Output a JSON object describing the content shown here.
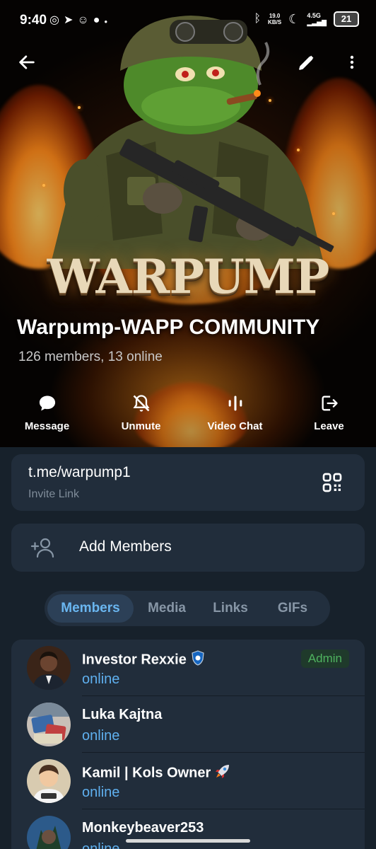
{
  "status_bar": {
    "time": "9:40",
    "speed_value": "19.0",
    "speed_unit": "KB/S",
    "network": "4.5G",
    "battery": "21"
  },
  "header": {
    "logo_text": "WARPUMP",
    "title": "Warpump-WAPP COMMUNITY",
    "subtitle": "126 members, 13 online"
  },
  "actions": [
    {
      "label": "Message",
      "icon": "chat-bubble-icon"
    },
    {
      "label": "Unmute",
      "icon": "bell-off-icon"
    },
    {
      "label": "Video Chat",
      "icon": "audio-bars-icon"
    },
    {
      "label": "Leave",
      "icon": "exit-icon"
    }
  ],
  "invite": {
    "url": "t.me/warpump1",
    "label": "Invite Link"
  },
  "add_members": {
    "label": "Add Members"
  },
  "tabs": [
    "Members",
    "Media",
    "Links",
    "GIFs"
  ],
  "members": [
    {
      "name": "Investor Rexxie",
      "status": "online",
      "badge": "Admin"
    },
    {
      "name": "Luka Kajtna",
      "status": "online"
    },
    {
      "name": "Kamil | Kols Owner",
      "status": "online"
    },
    {
      "name": "Monkeybeaver253",
      "status": "online"
    }
  ],
  "colors": {
    "background": "#17212b",
    "card": "#212d3b",
    "accent": "#6ab6f0",
    "online": "#5fb0ef",
    "admin": "#4fb35f"
  }
}
